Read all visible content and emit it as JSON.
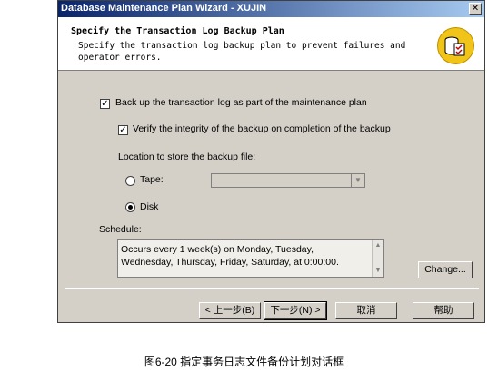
{
  "window": {
    "title": "Database Maintenance Plan Wizard - XUJIN",
    "close_glyph": "✕"
  },
  "header": {
    "title": "Specify the Transaction Log Backup Plan",
    "description": "Specify the transaction log backup plan to prevent failures and operator errors."
  },
  "options": {
    "backup_log": {
      "label": "Back up the transaction log as part of the maintenance plan",
      "checked": true
    },
    "verify": {
      "label": "Verify the integrity of the backup on completion of the backup",
      "checked": true
    },
    "location_label": "Location to store the backup file:",
    "tape": {
      "label": "Tape:",
      "selected": false
    },
    "disk": {
      "label": "Disk",
      "selected": true
    }
  },
  "schedule": {
    "label": "Schedule:",
    "text": "Occurs every 1 week(s) on Monday, Tuesday, Wednesday, Thursday, Friday, Saturday, at 0:00:00.",
    "change_button": "Change..."
  },
  "buttons": {
    "back": "< 上一步(B)",
    "next": "下一步(N) >",
    "cancel": "取消",
    "help": "帮助"
  },
  "caption": "图6-20 指定事务日志文件备份计划对话框",
  "colors": {
    "titlebar_start": "#0a246a",
    "titlebar_end": "#a6caf0",
    "face": "#d4d0c8",
    "icon_gold": "#f0c418"
  }
}
